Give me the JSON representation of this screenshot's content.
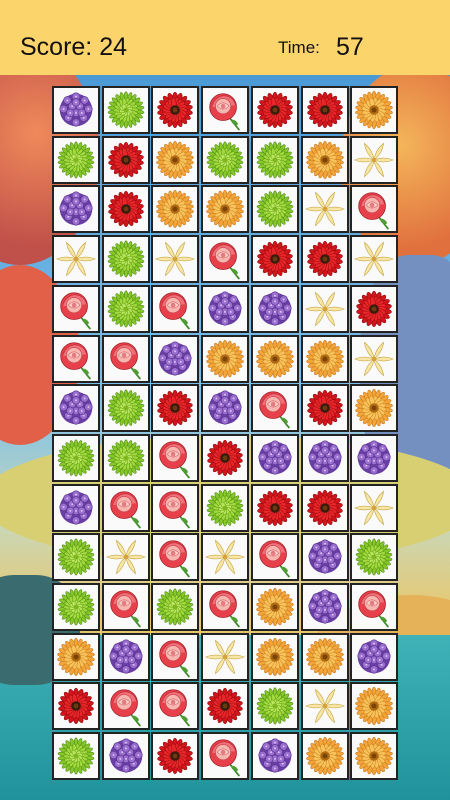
{
  "hud": {
    "score_label": "Score: 24",
    "time_label": "Time:",
    "time_value": "57"
  },
  "board": {
    "rows": 14,
    "cols": 7,
    "cells": [
      [
        "hydrangea",
        "chrysanthemum",
        "gerbera",
        "rose",
        "gerbera",
        "gerbera",
        "sunflower"
      ],
      [
        "chrysanthemum",
        "gerbera",
        "sunflower",
        "chrysanthemum",
        "chrysanthemum",
        "sunflower",
        "lily"
      ],
      [
        "hydrangea",
        "gerbera",
        "sunflower",
        "sunflower",
        "chrysanthemum",
        "lily",
        "rose"
      ],
      [
        "lily",
        "chrysanthemum",
        "lily",
        "rose",
        "gerbera",
        "gerbera",
        "lily"
      ],
      [
        "rose",
        "chrysanthemum",
        "rose",
        "hydrangea",
        "hydrangea",
        "lily",
        "gerbera"
      ],
      [
        "rose",
        "rose",
        "hydrangea",
        "sunflower",
        "sunflower",
        "sunflower",
        "lily"
      ],
      [
        "hydrangea",
        "chrysanthemum",
        "gerbera",
        "hydrangea",
        "rose",
        "gerbera",
        "sunflower"
      ],
      [
        "chrysanthemum",
        "chrysanthemum",
        "rose",
        "gerbera",
        "hydrangea",
        "hydrangea",
        "hydrangea"
      ],
      [
        "hydrangea",
        "rose",
        "rose",
        "chrysanthemum",
        "gerbera",
        "gerbera",
        "lily"
      ],
      [
        "chrysanthemum",
        "lily",
        "rose",
        "lily",
        "rose",
        "hydrangea",
        "chrysanthemum"
      ],
      [
        "chrysanthemum",
        "rose",
        "chrysanthemum",
        "rose",
        "sunflower",
        "hydrangea",
        "rose"
      ],
      [
        "sunflower",
        "hydrangea",
        "rose",
        "lily",
        "sunflower",
        "sunflower",
        "hydrangea"
      ],
      [
        "gerbera",
        "rose",
        "rose",
        "gerbera",
        "chrysanthemum",
        "lily",
        "sunflower"
      ],
      [
        "chrysanthemum",
        "hydrangea",
        "gerbera",
        "rose",
        "hydrangea",
        "sunflower",
        "sunflower"
      ]
    ]
  },
  "colors": {
    "header_bg": "#fcd46c",
    "tile_bg": "#fafafa",
    "tile_border": "#232323"
  }
}
